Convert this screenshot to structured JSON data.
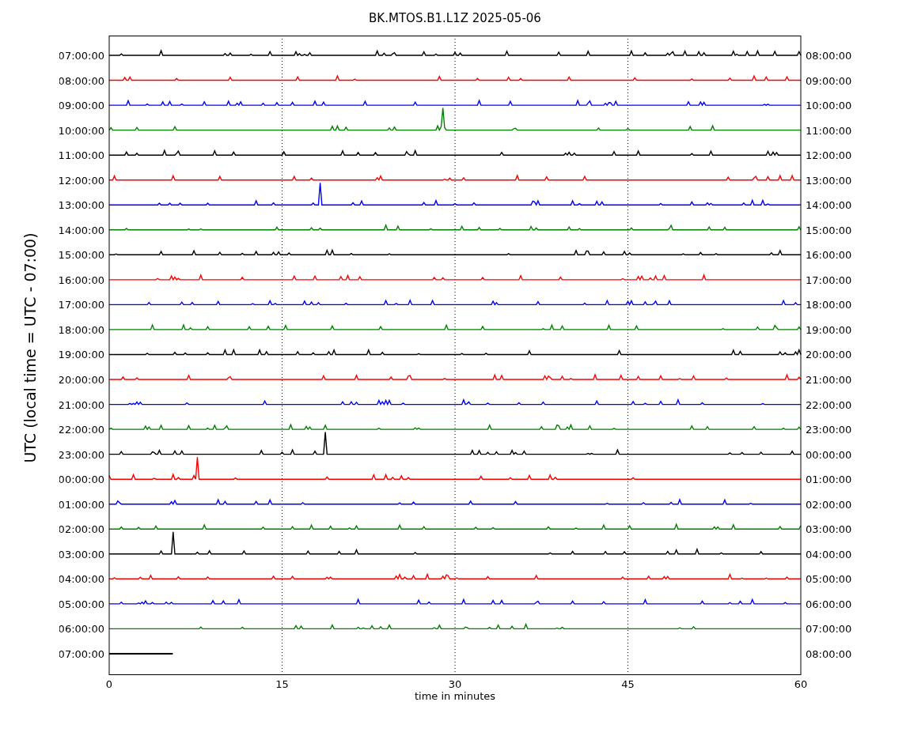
{
  "title": "BK.MTOS.B1.L1Z 2025-05-06",
  "ylabel": "UTC (local time = UTC - 07:00)",
  "xlabel": "time in minutes",
  "xticks": [
    "0",
    "15",
    "30",
    "45",
    "60"
  ],
  "traces": [
    {
      "left": "07:00:00",
      "right": "08:00:00",
      "color": "#000000",
      "kind": "full"
    },
    {
      "left": "08:00:00",
      "right": "09:00:00",
      "color": "#ff0000",
      "kind": "full"
    },
    {
      "left": "09:00:00",
      "right": "10:00:00",
      "color": "#0000ff",
      "kind": "full"
    },
    {
      "left": "10:00:00",
      "right": "11:00:00",
      "color": "#008000",
      "kind": "full"
    },
    {
      "left": "11:00:00",
      "right": "12:00:00",
      "color": "#000000",
      "kind": "full"
    },
    {
      "left": "12:00:00",
      "right": "13:00:00",
      "color": "#ff0000",
      "kind": "full"
    },
    {
      "left": "13:00:00",
      "right": "14:00:00",
      "color": "#0000ff",
      "kind": "full"
    },
    {
      "left": "14:00:00",
      "right": "15:00:00",
      "color": "#008000",
      "kind": "full"
    },
    {
      "left": "15:00:00",
      "right": "16:00:00",
      "color": "#000000",
      "kind": "full"
    },
    {
      "left": "16:00:00",
      "right": "17:00:00",
      "color": "#ff0000",
      "kind": "full"
    },
    {
      "left": "17:00:00",
      "right": "18:00:00",
      "color": "#0000ff",
      "kind": "full"
    },
    {
      "left": "18:00:00",
      "right": "19:00:00",
      "color": "#008000",
      "kind": "full"
    },
    {
      "left": "19:00:00",
      "right": "20:00:00",
      "color": "#000000",
      "kind": "full"
    },
    {
      "left": "20:00:00",
      "right": "21:00:00",
      "color": "#ff0000",
      "kind": "full"
    },
    {
      "left": "21:00:00",
      "right": "22:00:00",
      "color": "#0000ff",
      "kind": "full"
    },
    {
      "left": "22:00:00",
      "right": "23:00:00",
      "color": "#008000",
      "kind": "full"
    },
    {
      "left": "23:00:00",
      "right": "00:00:00",
      "color": "#000000",
      "kind": "full"
    },
    {
      "left": "00:00:00",
      "right": "01:00:00",
      "color": "#ff0000",
      "kind": "full"
    },
    {
      "left": "01:00:00",
      "right": "02:00:00",
      "color": "#0000ff",
      "kind": "full"
    },
    {
      "left": "02:00:00",
      "right": "03:00:00",
      "color": "#008000",
      "kind": "full"
    },
    {
      "left": "03:00:00",
      "right": "04:00:00",
      "color": "#000000",
      "kind": "full"
    },
    {
      "left": "04:00:00",
      "right": "05:00:00",
      "color": "#ff0000",
      "kind": "full"
    },
    {
      "left": "05:00:00",
      "right": "06:00:00",
      "color": "#0000ff",
      "kind": "full"
    },
    {
      "left": "06:00:00",
      "right": "07:00:00",
      "color": "#008000",
      "kind": "full"
    },
    {
      "left": "07:00:00",
      "right": "08:00:00",
      "color": "#000000",
      "kind": "partial"
    }
  ]
}
